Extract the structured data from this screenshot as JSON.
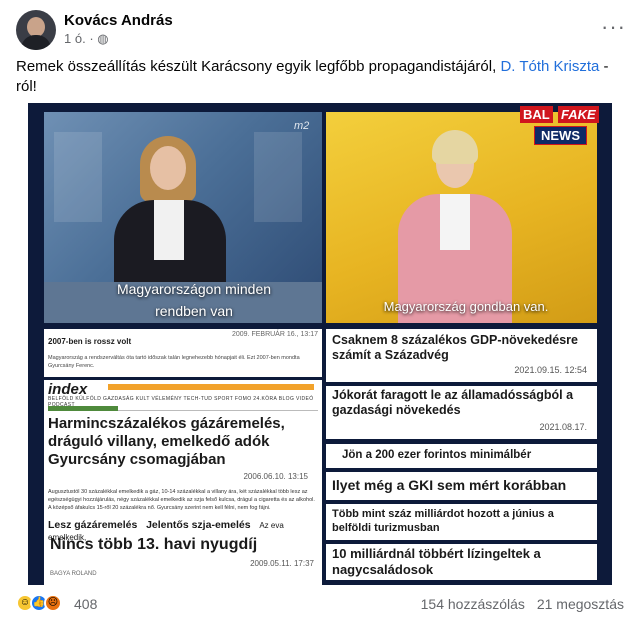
{
  "author": {
    "name": "Kovács András",
    "time": "1 ó."
  },
  "caption": {
    "text": "Remek összeállítás készült Karácsony egyik legfőbb propagandistájáról, ",
    "link": "D. Tóth Kriszta",
    "suffix": " -ról!"
  },
  "image": {
    "left_video": {
      "subtitle_line1": "Magyarországon minden",
      "subtitle_line2": "rendben van",
      "channel": "m2"
    },
    "right_video": {
      "subtitle": "Magyarország gondban van.",
      "logo_bal": "BAL",
      "logo_fake": "FAKE",
      "logo_news": "NEWS"
    },
    "clip1": {
      "title": "2007-ben is rossz volt",
      "date": "2009. FEBRUÁR 16., 13:17",
      "body": "Magyarország a rendszerváltás óta tartó időszak talán legnehezebb hónapjait éli. Ezt 2007-ben mondta Gyurcsány Ferenc."
    },
    "clip2": {
      "brand": "index",
      "nav": "BELFÖLD  KÜLFÖLD  GAZDASÁG  KULT  VÉLEMÉNY  TECH-TUD  SPORT  FOMO  24.KÖRA  BLOG  VIDEÓ  PODCAST",
      "headline": "Harmincszázalékos gázáremelés, dráguló villany, emelkedő adók Gyurcsány csomagjában",
      "date": "2006.06.10. 13:15",
      "body": "Augusztustól 30 százalékkal emelkedik a gáz, 10-14 százalékkal a villany ára, két százalékkal több lesz az egészségügyi hozzájárulás, négy százalékkal emelkedik az szja felső kulcsa, drágul a cigaretta és az alkohol. A középső áfakulcs 15-ről 20 százalékra nő. Gyurcsány szerint nem kell félni, nem fog fájni."
    },
    "clip3": {
      "t1": "Lesz gázáremelés",
      "t2": "Jelentős szja-emelés",
      "t3": "Az eva emelkedik,",
      "headline": "Nincs több 13. havi nyugdíj",
      "date": "2009.05.11. 17:37",
      "source": "BAGYA ROLAND"
    },
    "clip4": {
      "headline": "Csaknem 8 százalékos GDP-növekedésre számít a Századvég",
      "date": "2021.09.15. 12:54"
    },
    "clip5": {
      "headline": "Jókorát faragott le az államadósságból a gazdasági növekedés",
      "date": "2021.08.17."
    },
    "clip6": {
      "headline": "Jön a 200 ezer forintos minimálbér"
    },
    "clip7": {
      "headline": "Ilyet még a GKI sem mért korábban"
    },
    "clip8": {
      "headline": "Több mint száz milliárdot hozott a június a belföldi turizmusban"
    },
    "clip9": {
      "headline": "10 milliárdnál többért lízingeltek a nagycsaládosok"
    }
  },
  "footer": {
    "reaction_count": "408",
    "comments": "154 hozzászólás",
    "shares": "21 megosztás"
  },
  "colors": {
    "link": "#216fdb",
    "media_bg": "#0d1a3a",
    "brand_red": "#d0161d"
  }
}
